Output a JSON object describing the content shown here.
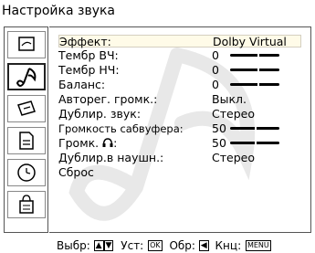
{
  "title": "Настройка звука",
  "sidebar": {
    "items": [
      {
        "name": "picture-icon"
      },
      {
        "name": "sound-icon",
        "active": true
      },
      {
        "name": "screen-icon"
      },
      {
        "name": "setup-icon"
      },
      {
        "name": "timer-icon"
      },
      {
        "name": "parental-icon"
      }
    ]
  },
  "menu": {
    "items": [
      {
        "label": "Эффект:",
        "value": "Dolby Virtual"
      },
      {
        "label": "Тембр ВЧ:",
        "value": "0",
        "slider": 0.55
      },
      {
        "label": "Тембр НЧ:",
        "value": "0",
        "slider": 0.55
      },
      {
        "label": "Баланс:",
        "value": "0",
        "slider": 0.55
      },
      {
        "label": "Авторег. громк.:",
        "value": "Выкл."
      },
      {
        "label": "Дублир. звук:",
        "value": "Стерео"
      },
      {
        "label": "Громкость сабвуфера:",
        "value": "50",
        "slider": 0.5
      },
      {
        "label": "Громк.",
        "value": "50",
        "slider": 0.5
      },
      {
        "label": "Дублир.в наушн.:",
        "value": "Стерео"
      },
      {
        "label": "Сброс",
        "value": ""
      }
    ]
  },
  "footer": {
    "select": "Выбр:",
    "set": "Уст:",
    "set_key": "OK",
    "back": "Обр:",
    "end": "Кнц:",
    "end_key": "MENU"
  },
  "colors": {
    "highlight": "#fffbe8",
    "watermark": "#e8e8e8"
  }
}
